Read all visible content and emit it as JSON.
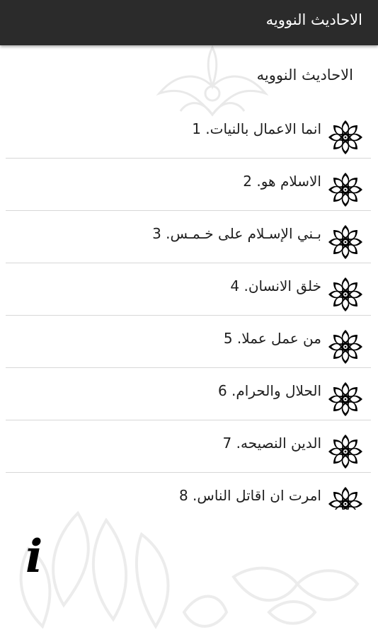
{
  "appbar": {
    "title": "الاحاديث النوويه"
  },
  "page": {
    "heading": "الاحاديث النوويه"
  },
  "list": {
    "items": [
      {
        "number": "1",
        "title": "انما الاعمال بالنيات",
        "label": "1 .انما الاعمال بالنيات"
      },
      {
        "number": "2",
        "title": "الاسلام هو",
        "label": "2 .الاسلام هو"
      },
      {
        "number": "3",
        "title": "بـني الإسـلام على خـمـس",
        "label": "3 .بـني الإسـلام على خـمـس"
      },
      {
        "number": "4",
        "title": "خلق الانسان",
        "label": "4 .خلق الانسان"
      },
      {
        "number": "5",
        "title": "من عمل عملا",
        "label": "5 .من عمل عملا"
      },
      {
        "number": "6",
        "title": "الحلال والحرام",
        "label": "6 .الحلال والحرام"
      },
      {
        "number": "7",
        "title": "الدين النصيحه",
        "label": "7 .الدين النصيحه"
      },
      {
        "number": "8",
        "title": "امرت ان اقاتل الناس",
        "label": "8 .امرت ان اقاتل الناس"
      }
    ],
    "icon": "flower-ornament-icon"
  },
  "info": {
    "glyph": "i",
    "icon": "info-icon"
  },
  "colors": {
    "appbar": "#2b2b2b",
    "divider": "#d7d7d7",
    "text": "#1e1e1e"
  }
}
